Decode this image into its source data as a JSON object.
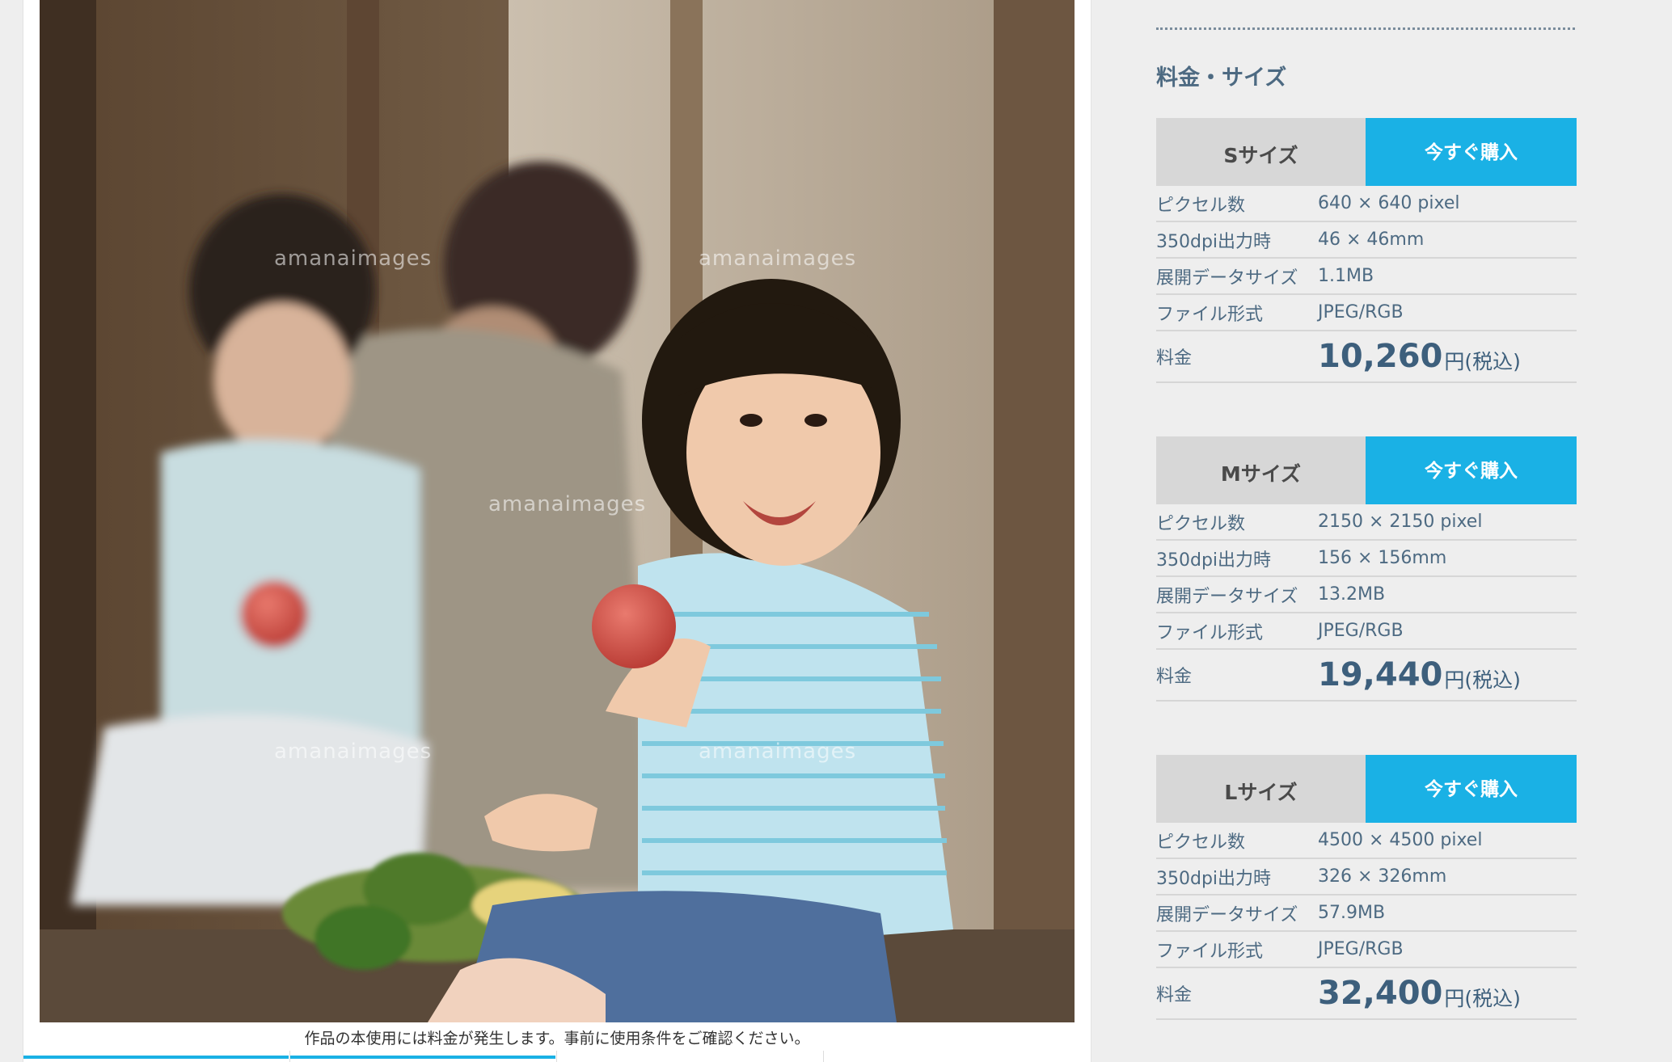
{
  "photo": {
    "watermarks": [
      "amanaimages",
      "amanaimages",
      "amanaimages",
      "amanaimages",
      "amanaimages"
    ]
  },
  "notice": "作品の本使用には料金が発生します。事前に使用条件をご確認ください。",
  "pricing": {
    "title": "料金・サイズ",
    "sizes": [
      {
        "label": "Sサイズ",
        "buy_label": "今すぐ購入",
        "specs": [
          {
            "key": "ピクセル数",
            "value": "640 × 640 pixel"
          },
          {
            "key": "350dpi出力時",
            "value": "46 × 46mm"
          },
          {
            "key": "展開データサイズ",
            "value": "1.1MB"
          },
          {
            "key": "ファイル形式",
            "value": "JPEG/RGB"
          }
        ],
        "price_key": "料金",
        "price": "10,260",
        "price_unit": "円(税込)"
      },
      {
        "label": "Mサイズ",
        "buy_label": "今すぐ購入",
        "specs": [
          {
            "key": "ピクセル数",
            "value": "2150 × 2150 pixel"
          },
          {
            "key": "350dpi出力時",
            "value": "156 × 156mm"
          },
          {
            "key": "展開データサイズ",
            "value": "13.2MB"
          },
          {
            "key": "ファイル形式",
            "value": "JPEG/RGB"
          }
        ],
        "price_key": "料金",
        "price": "19,440",
        "price_unit": "円(税込)"
      },
      {
        "label": "Lサイズ",
        "buy_label": "今すぐ購入",
        "specs": [
          {
            "key": "ピクセル数",
            "value": "4500 × 4500 pixel"
          },
          {
            "key": "350dpi出力時",
            "value": "326 × 326mm"
          },
          {
            "key": "展開データサイズ",
            "value": "57.9MB"
          },
          {
            "key": "ファイル形式",
            "value": "JPEG/RGB"
          }
        ],
        "price_key": "料金",
        "price": "32,400",
        "price_unit": "円(税込)"
      }
    ]
  },
  "colors": {
    "accent": "#1ab1e5",
    "label_text": "#4d6a82",
    "size_label_bg": "#d7d7d7"
  }
}
